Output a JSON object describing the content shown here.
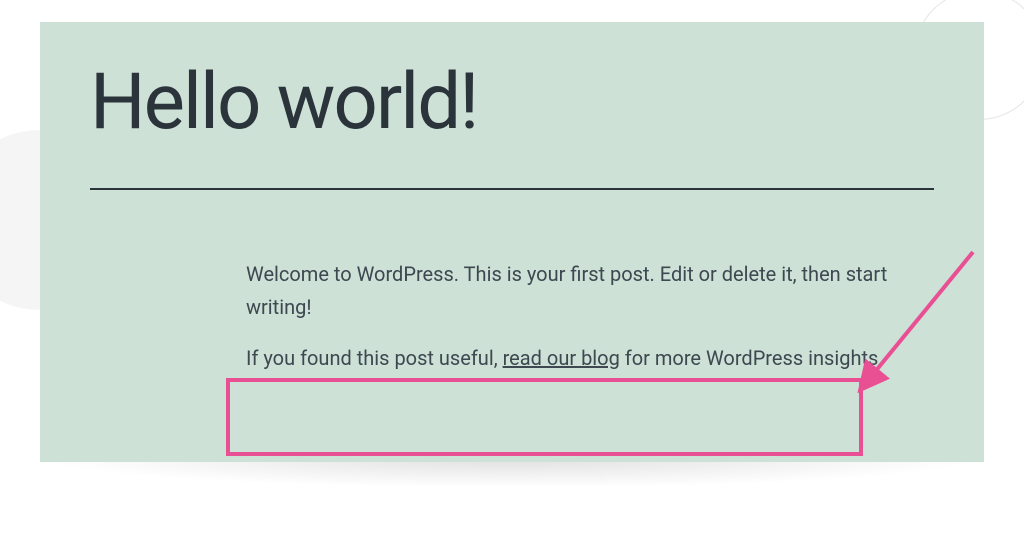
{
  "post": {
    "title": "Hello world!",
    "paragraph1": "Welcome to WordPress. This is your first post. Edit or delete it, then start writing!",
    "paragraph2_before": "If you found this post useful, ",
    "paragraph2_link": "read our blog",
    "paragraph2_after": " for more WordPress insights."
  },
  "annotation": {
    "highlight_color": "#e94f93"
  }
}
